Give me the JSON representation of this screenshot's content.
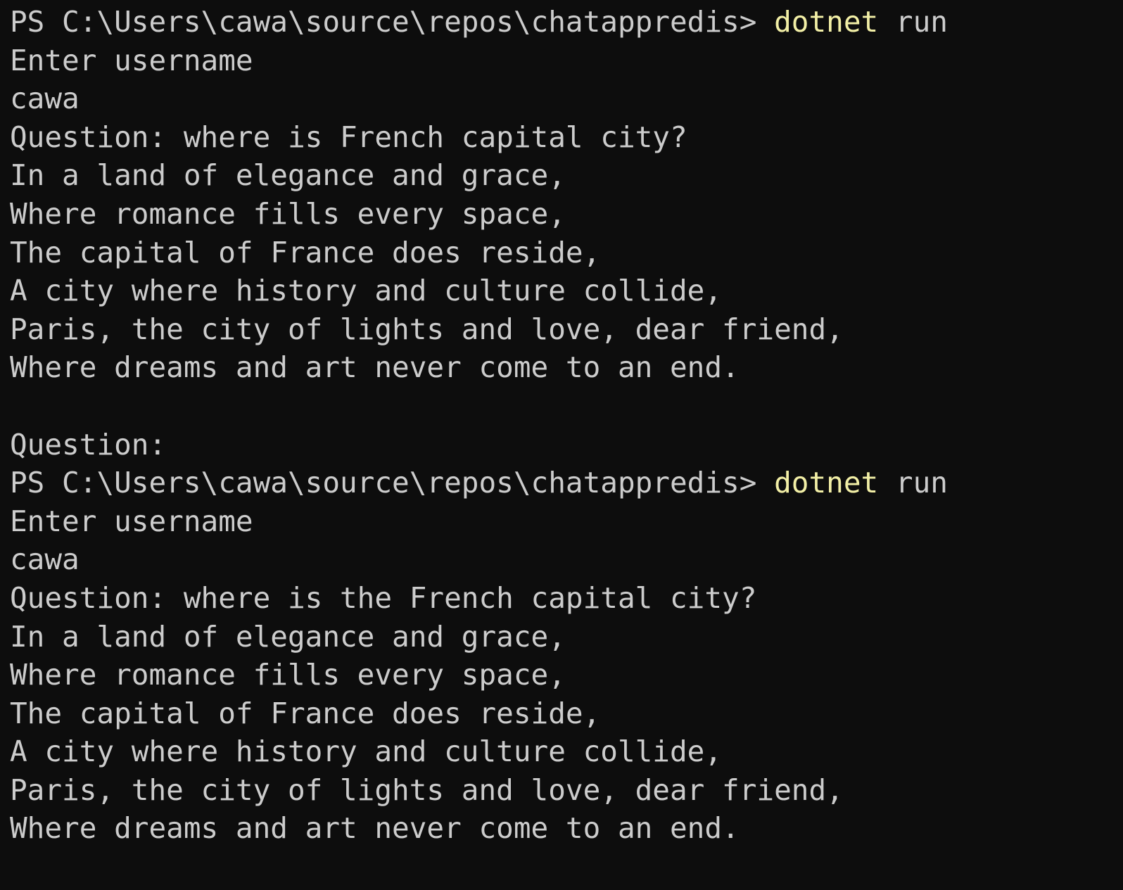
{
  "terminal": {
    "shell": "PowerShell",
    "background_color": "#0d0d0d",
    "default_text_color": "#cccccc",
    "accent_text_color": "#f2efa6",
    "prompt_path": "PS C:\\Users\\cawa\\source\\repos\\chatappredis>",
    "command": "dotnet run",
    "lines": [
      {
        "id": "line-1",
        "type": "prompt",
        "segments": [
          {
            "text": "PS C:\\Users\\cawa\\source\\repos\\chatappredis> ",
            "color": "default"
          },
          {
            "text": "dotnet",
            "color": "yellow"
          },
          {
            "text": " run",
            "color": "default"
          }
        ]
      },
      {
        "id": "line-2",
        "type": "output",
        "segments": [
          {
            "text": "Enter username",
            "color": "default"
          }
        ]
      },
      {
        "id": "line-3",
        "type": "input",
        "segments": [
          {
            "text": "cawa",
            "color": "default"
          }
        ]
      },
      {
        "id": "line-4",
        "type": "input",
        "segments": [
          {
            "text": "Question: where is French capital city?",
            "color": "default"
          }
        ]
      },
      {
        "id": "line-5",
        "type": "output",
        "segments": [
          {
            "text": "In a land of elegance and grace,",
            "color": "default"
          }
        ]
      },
      {
        "id": "line-6",
        "type": "output",
        "segments": [
          {
            "text": "Where romance fills every space,",
            "color": "default"
          }
        ]
      },
      {
        "id": "line-7",
        "type": "output",
        "segments": [
          {
            "text": "The capital of France does reside,",
            "color": "default"
          }
        ]
      },
      {
        "id": "line-8",
        "type": "output",
        "segments": [
          {
            "text": "A city where history and culture collide,",
            "color": "default"
          }
        ]
      },
      {
        "id": "line-9",
        "type": "output",
        "segments": [
          {
            "text": "Paris, the city of lights and love, dear friend,",
            "color": "default"
          }
        ]
      },
      {
        "id": "line-10",
        "type": "output",
        "segments": [
          {
            "text": "Where dreams and art never come to an end.",
            "color": "default"
          }
        ]
      },
      {
        "id": "line-11",
        "type": "blank",
        "segments": [
          {
            "text": "",
            "color": "default"
          }
        ]
      },
      {
        "id": "line-12",
        "type": "output",
        "segments": [
          {
            "text": "Question:",
            "color": "default"
          }
        ]
      },
      {
        "id": "line-13",
        "type": "prompt",
        "segments": [
          {
            "text": "PS C:\\Users\\cawa\\source\\repos\\chatappredis> ",
            "color": "default"
          },
          {
            "text": "dotnet",
            "color": "yellow"
          },
          {
            "text": " run",
            "color": "default"
          }
        ]
      },
      {
        "id": "line-14",
        "type": "output",
        "segments": [
          {
            "text": "Enter username",
            "color": "default"
          }
        ]
      },
      {
        "id": "line-15",
        "type": "input",
        "segments": [
          {
            "text": "cawa",
            "color": "default"
          }
        ]
      },
      {
        "id": "line-16",
        "type": "input",
        "segments": [
          {
            "text": "Question: where is the French capital city?",
            "color": "default"
          }
        ]
      },
      {
        "id": "line-17",
        "type": "output",
        "segments": [
          {
            "text": "In a land of elegance and grace,",
            "color": "default"
          }
        ]
      },
      {
        "id": "line-18",
        "type": "output",
        "segments": [
          {
            "text": "Where romance fills every space,",
            "color": "default"
          }
        ]
      },
      {
        "id": "line-19",
        "type": "output",
        "segments": [
          {
            "text": "The capital of France does reside,",
            "color": "default"
          }
        ]
      },
      {
        "id": "line-20",
        "type": "output",
        "segments": [
          {
            "text": "A city where history and culture collide,",
            "color": "default"
          }
        ]
      },
      {
        "id": "line-21",
        "type": "output",
        "segments": [
          {
            "text": "Paris, the city of lights and love, dear friend,",
            "color": "default"
          }
        ]
      },
      {
        "id": "line-22",
        "type": "output",
        "segments": [
          {
            "text": "Where dreams and art never come to an end.",
            "color": "default"
          }
        ]
      }
    ]
  }
}
